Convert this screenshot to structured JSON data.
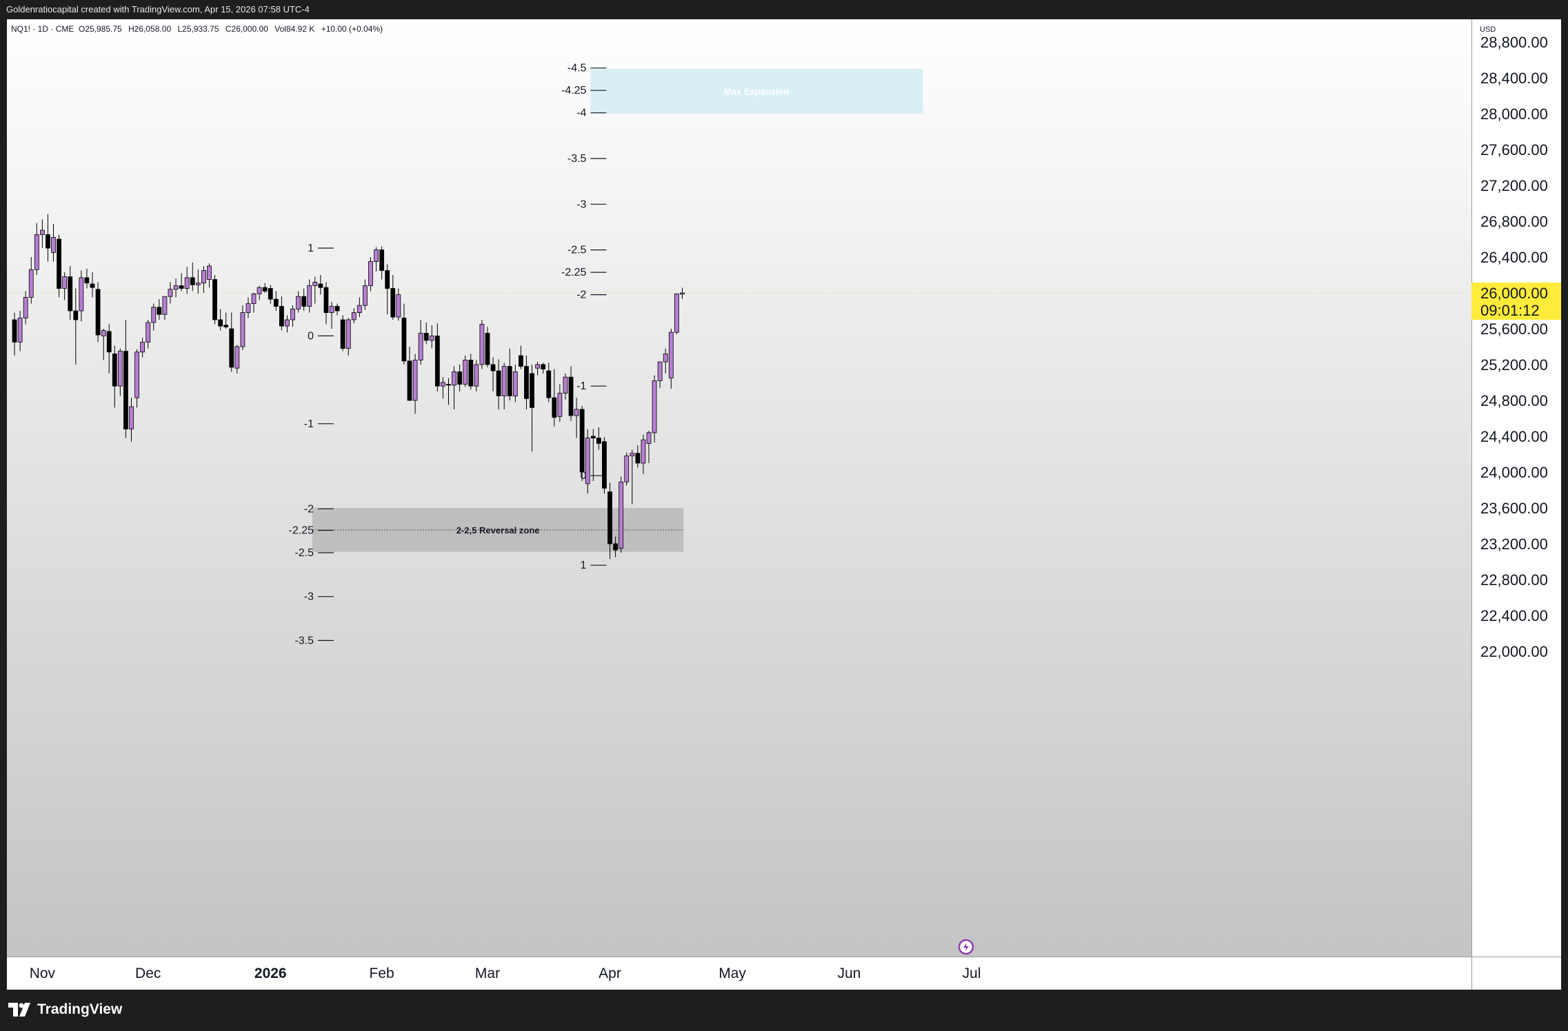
{
  "header": {
    "caption": "Goldenratiocapital created with TradingView.com, Apr 15, 2026 07:58 UTC-4"
  },
  "legend": {
    "symbol": "NQ1! · 1D · CME",
    "open": "O25,985.75",
    "high": "H26,058.00",
    "low": "L25,933.75",
    "close": "C26,000.00",
    "volume": "Vol84.92 K",
    "change": "+10.00 (+0.04%)"
  },
  "price_axis": {
    "currency": "USD",
    "current_price": "26,000.00",
    "countdown": "09:01:12",
    "ticks": [
      "28,800.00",
      "28,400.00",
      "28,000.00",
      "27,600.00",
      "27,200.00",
      "26,800.00",
      "26,400.00",
      "25,600.00",
      "25,200.00",
      "24,800.00",
      "24,400.00",
      "24,000.00",
      "23,600.00",
      "23,200.00",
      "22,800.00",
      "22,400.00",
      "22,000.00"
    ]
  },
  "time_axis": {
    "labels": [
      {
        "text": "Nov",
        "bold": false
      },
      {
        "text": "Dec",
        "bold": false
      },
      {
        "text": "2026",
        "bold": true
      },
      {
        "text": "Feb",
        "bold": false
      },
      {
        "text": "Mar",
        "bold": false
      },
      {
        "text": "Apr",
        "bold": false
      },
      {
        "text": "May",
        "bold": false
      },
      {
        "text": "Jun",
        "bold": false
      },
      {
        "text": "Jul",
        "bold": false
      }
    ]
  },
  "footer": {
    "brand": "TradingView"
  },
  "colors": {
    "bull_candle": "#b77ed1",
    "bear_candle": "#000000",
    "current_price_tag": "#ffeb3b",
    "max_expansion_zone": "#d8eff4",
    "reversal_zone": "#b9b9b9"
  },
  "chart_data": {
    "type": "candlestick",
    "symbol": "NQ1!",
    "interval": "1D",
    "ylim": [
      21900,
      29100
    ],
    "y_axis_side": "right",
    "candles": [
      {
        "d": "2025-10-27",
        "o": 25700,
        "h": 25780,
        "l": 25300,
        "c": 25450
      },
      {
        "d": "2025-10-28",
        "o": 25450,
        "h": 25800,
        "l": 25350,
        "c": 25720
      },
      {
        "d": "2025-10-29",
        "o": 25720,
        "h": 26020,
        "l": 25650,
        "c": 25950
      },
      {
        "d": "2025-10-30",
        "o": 25950,
        "h": 26400,
        "l": 25880,
        "c": 26260
      },
      {
        "d": "2025-10-31",
        "o": 26260,
        "h": 26780,
        "l": 26200,
        "c": 26650
      },
      {
        "d": "2025-11-03",
        "o": 26650,
        "h": 26820,
        "l": 26500,
        "c": 26700
      },
      {
        "d": "2025-11-04",
        "o": 26650,
        "h": 26880,
        "l": 26350,
        "c": 26500
      },
      {
        "d": "2025-11-05",
        "o": 26450,
        "h": 26770,
        "l": 26350,
        "c": 26620
      },
      {
        "d": "2025-11-06",
        "o": 26600,
        "h": 26650,
        "l": 25950,
        "c": 26050
      },
      {
        "d": "2025-11-07",
        "o": 26050,
        "h": 26230,
        "l": 25920,
        "c": 26180
      },
      {
        "d": "2025-11-10",
        "o": 26180,
        "h": 26300,
        "l": 25700,
        "c": 25800
      },
      {
        "d": "2025-11-11",
        "o": 25800,
        "h": 26050,
        "l": 25200,
        "c": 25700
      },
      {
        "d": "2025-11-12",
        "o": 25800,
        "h": 26250,
        "l": 25680,
        "c": 26170
      },
      {
        "d": "2025-11-13",
        "o": 26170,
        "h": 26270,
        "l": 26050,
        "c": 26110
      },
      {
        "d": "2025-11-14",
        "o": 26100,
        "h": 26230,
        "l": 25950,
        "c": 26060
      },
      {
        "d": "2025-11-17",
        "o": 26040,
        "h": 26120,
        "l": 25450,
        "c": 25530
      },
      {
        "d": "2025-11-18",
        "o": 25520,
        "h": 25600,
        "l": 25250,
        "c": 25580
      },
      {
        "d": "2025-11-19",
        "o": 25570,
        "h": 25650,
        "l": 25100,
        "c": 25340
      },
      {
        "d": "2025-11-20",
        "o": 25320,
        "h": 25410,
        "l": 24720,
        "c": 24960
      },
      {
        "d": "2025-11-21",
        "o": 24960,
        "h": 25380,
        "l": 24850,
        "c": 25350
      },
      {
        "d": "2025-11-24",
        "o": 25350,
        "h": 25700,
        "l": 24380,
        "c": 24480
      },
      {
        "d": "2025-11-25",
        "o": 24480,
        "h": 24830,
        "l": 24340,
        "c": 24730
      },
      {
        "d": "2025-11-26",
        "o": 24830,
        "h": 25370,
        "l": 24720,
        "c": 25340
      },
      {
        "d": "2025-11-28",
        "o": 25340,
        "h": 25500,
        "l": 25280,
        "c": 25450
      },
      {
        "d": "2025-12-01",
        "o": 25450,
        "h": 25700,
        "l": 25380,
        "c": 25670
      },
      {
        "d": "2025-12-02",
        "o": 25670,
        "h": 25880,
        "l": 25580,
        "c": 25840
      },
      {
        "d": "2025-12-03",
        "o": 25840,
        "h": 25930,
        "l": 25700,
        "c": 25760
      },
      {
        "d": "2025-12-04",
        "o": 25760,
        "h": 25960,
        "l": 25700,
        "c": 25960
      },
      {
        "d": "2025-12-05",
        "o": 25960,
        "h": 26120,
        "l": 25880,
        "c": 26040
      },
      {
        "d": "2025-12-08",
        "o": 26040,
        "h": 26160,
        "l": 25950,
        "c": 26080
      },
      {
        "d": "2025-12-09",
        "o": 26080,
        "h": 26220,
        "l": 26020,
        "c": 26050
      },
      {
        "d": "2025-12-10",
        "o": 26050,
        "h": 26290,
        "l": 25990,
        "c": 26170
      },
      {
        "d": "2025-12-11",
        "o": 26170,
        "h": 26340,
        "l": 26020,
        "c": 26090
      },
      {
        "d": "2025-12-12",
        "o": 26090,
        "h": 26260,
        "l": 25990,
        "c": 26110
      },
      {
        "d": "2025-12-15",
        "o": 26110,
        "h": 26300,
        "l": 26000,
        "c": 26250
      },
      {
        "d": "2025-12-16",
        "o": 26150,
        "h": 26330,
        "l": 26060,
        "c": 26300
      },
      {
        "d": "2025-12-17",
        "o": 26150,
        "h": 26200,
        "l": 25650,
        "c": 25700
      },
      {
        "d": "2025-12-18",
        "o": 25700,
        "h": 25820,
        "l": 25580,
        "c": 25630
      },
      {
        "d": "2025-12-19",
        "o": 25640,
        "h": 25780,
        "l": 25600,
        "c": 25620
      },
      {
        "d": "2025-12-22",
        "o": 25600,
        "h": 25780,
        "l": 25120,
        "c": 25170
      },
      {
        "d": "2025-12-23",
        "o": 25160,
        "h": 25420,
        "l": 25100,
        "c": 25400
      },
      {
        "d": "2025-12-24",
        "o": 25400,
        "h": 25860,
        "l": 25360,
        "c": 25780
      },
      {
        "d": "2025-12-26",
        "o": 25780,
        "h": 25950,
        "l": 25720,
        "c": 25880
      },
      {
        "d": "2025-12-29",
        "o": 25880,
        "h": 26000,
        "l": 25780,
        "c": 25990
      },
      {
        "d": "2025-12-30",
        "o": 25990,
        "h": 26080,
        "l": 25920,
        "c": 26060
      },
      {
        "d": "2025-12-31",
        "o": 26060,
        "h": 26110,
        "l": 26000,
        "c": 26020
      },
      {
        "d": "2026-01-02",
        "o": 26050,
        "h": 26090,
        "l": 25880,
        "c": 25930
      },
      {
        "d": "2026-01-05",
        "o": 25930,
        "h": 26020,
        "l": 25800,
        "c": 25850
      },
      {
        "d": "2026-01-06",
        "o": 25850,
        "h": 25960,
        "l": 25580,
        "c": 25630
      },
      {
        "d": "2026-01-07",
        "o": 25630,
        "h": 25750,
        "l": 25560,
        "c": 25700
      },
      {
        "d": "2026-01-08",
        "o": 25700,
        "h": 25860,
        "l": 25620,
        "c": 25820
      },
      {
        "d": "2026-01-09",
        "o": 25820,
        "h": 26020,
        "l": 25780,
        "c": 25960
      },
      {
        "d": "2026-01-12",
        "o": 25960,
        "h": 26050,
        "l": 25800,
        "c": 25850
      },
      {
        "d": "2026-01-13",
        "o": 25850,
        "h": 26150,
        "l": 25780,
        "c": 26080
      },
      {
        "d": "2026-01-14",
        "o": 26080,
        "h": 26180,
        "l": 25880,
        "c": 26120
      },
      {
        "d": "2026-01-15",
        "o": 26100,
        "h": 26200,
        "l": 25980,
        "c": 26060
      },
      {
        "d": "2026-01-16",
        "o": 26060,
        "h": 26120,
        "l": 25650,
        "c": 25780
      },
      {
        "d": "2026-01-20",
        "o": 25780,
        "h": 25900,
        "l": 25600,
        "c": 25850
      },
      {
        "d": "2026-01-21",
        "o": 25850,
        "h": 25880,
        "l": 25750,
        "c": 25800
      },
      {
        "d": "2026-01-22",
        "o": 25700,
        "h": 25750,
        "l": 25350,
        "c": 25380
      },
      {
        "d": "2026-01-23",
        "o": 25380,
        "h": 25720,
        "l": 25300,
        "c": 25700
      },
      {
        "d": "2026-01-26",
        "o": 25700,
        "h": 25830,
        "l": 25660,
        "c": 25780
      },
      {
        "d": "2026-01-27",
        "o": 25780,
        "h": 25950,
        "l": 25730,
        "c": 25860
      },
      {
        "d": "2026-01-28",
        "o": 25860,
        "h": 26150,
        "l": 25810,
        "c": 26080
      },
      {
        "d": "2026-01-29",
        "o": 26080,
        "h": 26400,
        "l": 26020,
        "c": 26350
      },
      {
        "d": "2026-01-30",
        "o": 26350,
        "h": 26510,
        "l": 26240,
        "c": 26480
      },
      {
        "d": "2026-02-02",
        "o": 26480,
        "h": 26520,
        "l": 26150,
        "c": 26250
      },
      {
        "d": "2026-02-03",
        "o": 26250,
        "h": 26320,
        "l": 25760,
        "c": 26050
      },
      {
        "d": "2026-02-04",
        "o": 26050,
        "h": 26200,
        "l": 25700,
        "c": 25730
      },
      {
        "d": "2026-02-05",
        "o": 25730,
        "h": 26050,
        "l": 25690,
        "c": 25980
      },
      {
        "d": "2026-02-06",
        "o": 25720,
        "h": 25880,
        "l": 25200,
        "c": 25240
      },
      {
        "d": "2026-02-09",
        "o": 25240,
        "h": 25400,
        "l": 24880,
        "c": 24800
      },
      {
        "d": "2026-02-10",
        "o": 24800,
        "h": 25320,
        "l": 24650,
        "c": 25250
      },
      {
        "d": "2026-02-11",
        "o": 25250,
        "h": 25700,
        "l": 25200,
        "c": 25550
      },
      {
        "d": "2026-02-12",
        "o": 25550,
        "h": 25670,
        "l": 25430,
        "c": 25470
      },
      {
        "d": "2026-02-13",
        "o": 25470,
        "h": 25640,
        "l": 25380,
        "c": 25520
      },
      {
        "d": "2026-02-17",
        "o": 25520,
        "h": 25660,
        "l": 24900,
        "c": 24960
      },
      {
        "d": "2026-02-18",
        "o": 24960,
        "h": 25060,
        "l": 24820,
        "c": 25000
      },
      {
        "d": "2026-02-19",
        "o": 24980,
        "h": 25050,
        "l": 24750,
        "c": 24970
      },
      {
        "d": "2026-02-20",
        "o": 24970,
        "h": 25180,
        "l": 24700,
        "c": 25120
      },
      {
        "d": "2026-02-23",
        "o": 25120,
        "h": 25200,
        "l": 24900,
        "c": 24980
      },
      {
        "d": "2026-02-24",
        "o": 24980,
        "h": 25300,
        "l": 24950,
        "c": 25250
      },
      {
        "d": "2026-02-25",
        "o": 25250,
        "h": 25320,
        "l": 24920,
        "c": 24960
      },
      {
        "d": "2026-02-26",
        "o": 24960,
        "h": 25250,
        "l": 24900,
        "c": 25200
      },
      {
        "d": "2026-02-27",
        "o": 25200,
        "h": 25700,
        "l": 25150,
        "c": 25650
      },
      {
        "d": "2026-03-02",
        "o": 25550,
        "h": 25620,
        "l": 25170,
        "c": 25200
      },
      {
        "d": "2026-03-03",
        "o": 25200,
        "h": 25280,
        "l": 24900,
        "c": 25130
      },
      {
        "d": "2026-03-04",
        "o": 25130,
        "h": 25260,
        "l": 24700,
        "c": 24850
      },
      {
        "d": "2026-03-05",
        "o": 24850,
        "h": 25220,
        "l": 24700,
        "c": 25180
      },
      {
        "d": "2026-03-06",
        "o": 25180,
        "h": 25380,
        "l": 24800,
        "c": 24850
      },
      {
        "d": "2026-03-09",
        "o": 24850,
        "h": 25200,
        "l": 24780,
        "c": 25120
      },
      {
        "d": "2026-03-10",
        "o": 25300,
        "h": 25410,
        "l": 25150,
        "c": 25180
      },
      {
        "d": "2026-03-11",
        "o": 25180,
        "h": 25300,
        "l": 24700,
        "c": 24820
      },
      {
        "d": "2026-03-12",
        "o": 25100,
        "h": 25200,
        "l": 24230,
        "c": 24720
      },
      {
        "d": "2026-03-13",
        "o": 25160,
        "h": 25230,
        "l": 25080,
        "c": 25200
      },
      {
        "d": "2026-03-16",
        "o": 25200,
        "h": 25220,
        "l": 25100,
        "c": 25150
      },
      {
        "d": "2026-03-17",
        "o": 25130,
        "h": 25220,
        "l": 24780,
        "c": 24830
      },
      {
        "d": "2026-03-18",
        "o": 24830,
        "h": 25150,
        "l": 24510,
        "c": 24610
      },
      {
        "d": "2026-03-19",
        "o": 24620,
        "h": 24980,
        "l": 24560,
        "c": 24880
      },
      {
        "d": "2026-03-20",
        "o": 24880,
        "h": 25100,
        "l": 24810,
        "c": 25060
      },
      {
        "d": "2026-03-23",
        "o": 25060,
        "h": 25180,
        "l": 24570,
        "c": 24630
      },
      {
        "d": "2026-03-24",
        "o": 24630,
        "h": 24830,
        "l": 24380,
        "c": 24700
      },
      {
        "d": "2026-03-25",
        "o": 24700,
        "h": 24740,
        "l": 23900,
        "c": 24000
      },
      {
        "d": "2026-03-26",
        "o": 23870,
        "h": 24480,
        "l": 23760,
        "c": 24380
      },
      {
        "d": "2026-03-27",
        "o": 24400,
        "h": 24480,
        "l": 23900,
        "c": 24380
      },
      {
        "d": "2026-03-30",
        "o": 24380,
        "h": 24500,
        "l": 24250,
        "c": 24320
      },
      {
        "d": "2026-03-31",
        "o": 24340,
        "h": 24390,
        "l": 23760,
        "c": 23820
      },
      {
        "d": "2026-04-01",
        "o": 23780,
        "h": 23880,
        "l": 23030,
        "c": 23200
      },
      {
        "d": "2026-04-02",
        "o": 23200,
        "h": 23280,
        "l": 23050,
        "c": 23130
      },
      {
        "d": "2026-04-03",
        "o": 23150,
        "h": 23950,
        "l": 23100,
        "c": 23890
      },
      {
        "d": "2026-04-06",
        "o": 23890,
        "h": 24220,
        "l": 23850,
        "c": 24180
      },
      {
        "d": "2026-04-07",
        "o": 24180,
        "h": 24250,
        "l": 23640,
        "c": 24210
      },
      {
        "d": "2026-04-08",
        "o": 24210,
        "h": 24300,
        "l": 24050,
        "c": 24100
      },
      {
        "d": "2026-04-09",
        "o": 24100,
        "h": 24420,
        "l": 23980,
        "c": 24360
      },
      {
        "d": "2026-04-10",
        "o": 24320,
        "h": 24460,
        "l": 24100,
        "c": 24440
      },
      {
        "d": "2026-04-13",
        "o": 24440,
        "h": 25080,
        "l": 24330,
        "c": 25020
      },
      {
        "d": "2026-04-14",
        "o": 25020,
        "h": 25220,
        "l": 24940,
        "c": 25230
      },
      {
        "d": "2026-04-15",
        "o": 25230,
        "h": 25380,
        "l": 25100,
        "c": 25320
      },
      {
        "d": "2026-04-16",
        "o": 25050,
        "h": 25600,
        "l": 24930,
        "c": 25560
      },
      {
        "d": "2026-04-17",
        "o": 25560,
        "h": 25990,
        "l": 25540,
        "c": 25990
      },
      {
        "d": "2026-04-20",
        "o": 25985.75,
        "h": 26058,
        "l": 25933.75,
        "c": 26000
      }
    ],
    "zones": [
      {
        "label": "Max Expansion",
        "from_date": "2026-03-31",
        "to_date": "2026-06-17",
        "top": 28500,
        "bottom": 28000
      },
      {
        "label": "2-2,5 Reversal zone",
        "from_date": "2026-01-16",
        "to_date": "2026-04-17",
        "top": 23600,
        "bottom": 23110
      }
    ],
    "fib_levels": [
      {
        "anchor_date": "2026-03-31",
        "label_side": "left",
        "levels": [
          {
            "label": "-4.5",
            "price": 28510
          },
          {
            "label": "-4.25",
            "price": 28260
          },
          {
            "label": "-4",
            "price": 28010
          },
          {
            "label": "-3.5",
            "price": 27500
          },
          {
            "label": "-3",
            "price": 26990
          },
          {
            "label": "-2.5",
            "price": 26480
          },
          {
            "label": "-2.25",
            "price": 26230
          },
          {
            "label": "-2",
            "price": 25980
          },
          {
            "label": "-1",
            "price": 24960
          },
          {
            "label": "0",
            "price": 23960
          },
          {
            "label": "1",
            "price": 22960
          }
        ]
      },
      {
        "anchor_date": "2026-01-20",
        "label_side": "left",
        "levels": [
          {
            "label": "1",
            "price": 26500
          },
          {
            "label": "0",
            "price": 25520
          },
          {
            "label": "-1",
            "price": 24540
          },
          {
            "label": "-2",
            "price": 23590
          },
          {
            "label": "-2.25",
            "price": 23350
          },
          {
            "label": "-2.5",
            "price": 23100
          },
          {
            "label": "-3",
            "price": 22610
          },
          {
            "label": "-3.5",
            "price": 22120
          }
        ]
      }
    ],
    "last_price": 26000
  }
}
